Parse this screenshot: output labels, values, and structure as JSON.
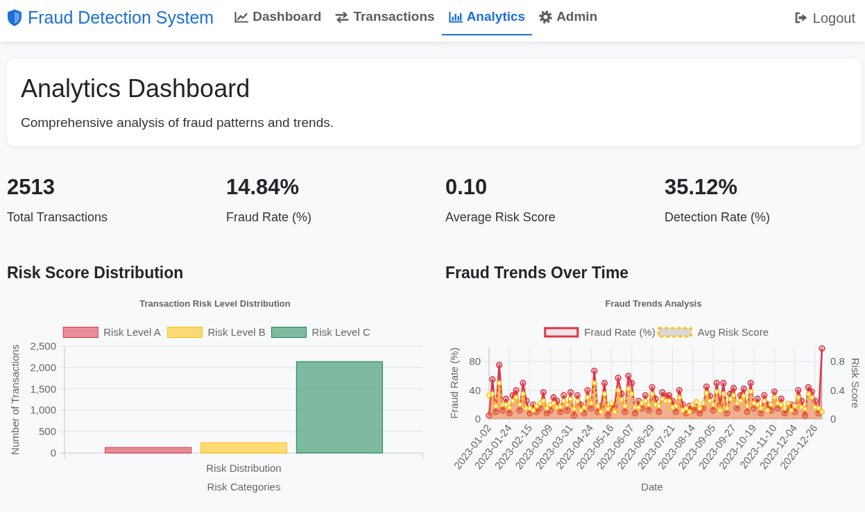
{
  "navbar": {
    "brand": "Fraud Detection System",
    "links": [
      {
        "label": "Dashboard",
        "selected": false
      },
      {
        "label": "Transactions",
        "selected": false
      },
      {
        "label": "Analytics",
        "selected": true
      },
      {
        "label": "Admin",
        "selected": false
      }
    ],
    "logout": "Logout"
  },
  "header": {
    "title": "Analytics Dashboard",
    "subtitle": "Comprehensive analysis of fraud patterns and trends."
  },
  "stats": [
    {
      "value": "2513",
      "label": "Total Transactions"
    },
    {
      "value": "14.84%",
      "label": "Fraud Rate (%)"
    },
    {
      "value": "0.10",
      "label": "Average Risk Score"
    },
    {
      "value": "35.12%",
      "label": "Detection Rate (%)"
    }
  ],
  "sections": [
    {
      "title": "Risk Score Distribution",
      "chart_data": {
        "type": "bar",
        "title": "Transaction Risk Level Distribution",
        "xlabel": "Risk Categories",
        "ylabel": "Number of Transactions",
        "categories": [
          "Risk Distribution"
        ],
        "series": [
          {
            "name": "Risk Level A",
            "color": "#dc3545",
            "values": [
              130
            ]
          },
          {
            "name": "Risk Level B",
            "color": "#ffc107",
            "values": [
              240
            ]
          },
          {
            "name": "Risk Level C",
            "color": "#198754",
            "values": [
              2140
            ]
          }
        ],
        "ylim": [
          0,
          2500
        ],
        "yticks": [
          0,
          500,
          {
            "value": 1000,
            "label": "1,000"
          },
          {
            "value": 1500,
            "label": "1,500"
          },
          {
            "value": 2000,
            "label": "2,000"
          },
          {
            "value": 2500,
            "label": "2,500"
          }
        ],
        "grid": true,
        "legend": "top"
      }
    },
    {
      "title": "Fraud Trends Over Time",
      "chart_data": {
        "type": "area",
        "title": "Fraud Trends Analysis",
        "xlabel": "Date",
        "ylabel": "Fraud Rate (%)",
        "y2label": "Risk Score",
        "categories": [
          "2023-01-02",
          null,
          null,
          null,
          null,
          null,
          "2023-01-24",
          null,
          null,
          null,
          null,
          null,
          "2023-02-15",
          null,
          null,
          null,
          null,
          null,
          "2023-03-09",
          null,
          null,
          null,
          null,
          null,
          "2023-03-31",
          null,
          null,
          null,
          null,
          null,
          "2023-04-24",
          null,
          null,
          null,
          null,
          null,
          "2023-05-16",
          null,
          null,
          null,
          null,
          null,
          "2023-06-07",
          null,
          null,
          null,
          null,
          null,
          "2023-06-29",
          null,
          null,
          null,
          null,
          null,
          "2023-07-21",
          null,
          null,
          null,
          null,
          null,
          "2023-08-14",
          null,
          null,
          null,
          null,
          null,
          "2023-09-05",
          null,
          null,
          null,
          null,
          null,
          "2023-09-27",
          null,
          null,
          null,
          null,
          null,
          "2023-10-19",
          null,
          null,
          null,
          null,
          null,
          "2023-11-10",
          null,
          null,
          null,
          null,
          null,
          "2023-12-04",
          null,
          null,
          null,
          null,
          null,
          "2023-12-26",
          null,
          null
        ],
        "ylim": [
          0,
          100
        ],
        "yticks": [
          0,
          40,
          80
        ],
        "y2lim": [
          0,
          1
        ],
        "y2ticks": [
          0,
          0.4,
          0.8
        ],
        "grid": true,
        "legend": "top",
        "series": [
          {
            "name": "Fraud Rate (%)",
            "color": "#dc3545",
            "axis": "y",
            "line_style": "solid",
            "marker": "circle",
            "values": [
              5,
              55,
              10,
              75,
              12,
              28,
              8,
              33,
              40,
              12,
              50,
              25,
              8,
              20,
              10,
              15,
              37,
              8,
              12,
              30,
              25,
              10,
              33,
              12,
              37,
              5,
              33,
              20,
              8,
              40,
              15,
              67,
              10,
              18,
              50,
              5,
              15,
              18,
              57,
              35,
              10,
              60,
              50,
              8,
              25,
              15,
              33,
              12,
              44,
              28,
              10,
              37,
              32,
              33,
              25,
              10,
              40,
              20,
              8,
              18,
              12,
              16,
              8,
              15,
              45,
              32,
              12,
              50,
              20,
              50,
              8,
              35,
              43,
              15,
              33,
              42,
              10,
              50,
              15,
              28,
              8,
              33,
              20,
              12,
              38,
              15,
              28,
              8,
              15,
              20,
              10,
              40,
              25,
              5,
              44,
              38,
              25,
              8,
              98
            ]
          },
          {
            "name": "Avg Risk Score",
            "color": "#ffc107",
            "axis": "y2",
            "line_style": "dashed",
            "marker": "circle",
            "values": [
              0.33,
              0.35,
              0.18,
              0.5,
              0.2,
              0.2,
              0.16,
              0.25,
              0.3,
              0.2,
              0.35,
              0.15,
              0.15,
              0.12,
              0.18,
              0.22,
              0.25,
              0.15,
              0.2,
              0.22,
              0.16,
              0.17,
              0.25,
              0.2,
              0.28,
              0.14,
              0.25,
              0.12,
              0.16,
              0.3,
              0.22,
              0.5,
              0.18,
              0.1,
              0.35,
              0.14,
              0.22,
              0.1,
              0.4,
              0.27,
              0.18,
              0.42,
              0.35,
              0.16,
              0.16,
              0.22,
              0.25,
              0.2,
              0.35,
              0.2,
              0.18,
              0.28,
              0.25,
              0.25,
              0.16,
              0.18,
              0.3,
              0.12,
              0.15,
              0.1,
              0.2,
              0.24,
              0.15,
              0.22,
              0.36,
              0.25,
              0.2,
              0.38,
              0.12,
              0.35,
              0.15,
              0.28,
              0.33,
              0.22,
              0.25,
              0.32,
              0.18,
              0.38,
              0.22,
              0.2,
              0.15,
              0.25,
              0.12,
              0.2,
              0.3,
              0.22,
              0.2,
              0.15,
              0.22,
              0.12,
              0.18,
              0.3,
              0.16,
              0.14,
              0.35,
              0.3,
              0.16,
              0.15,
              0.1
            ]
          }
        ]
      }
    }
  ]
}
